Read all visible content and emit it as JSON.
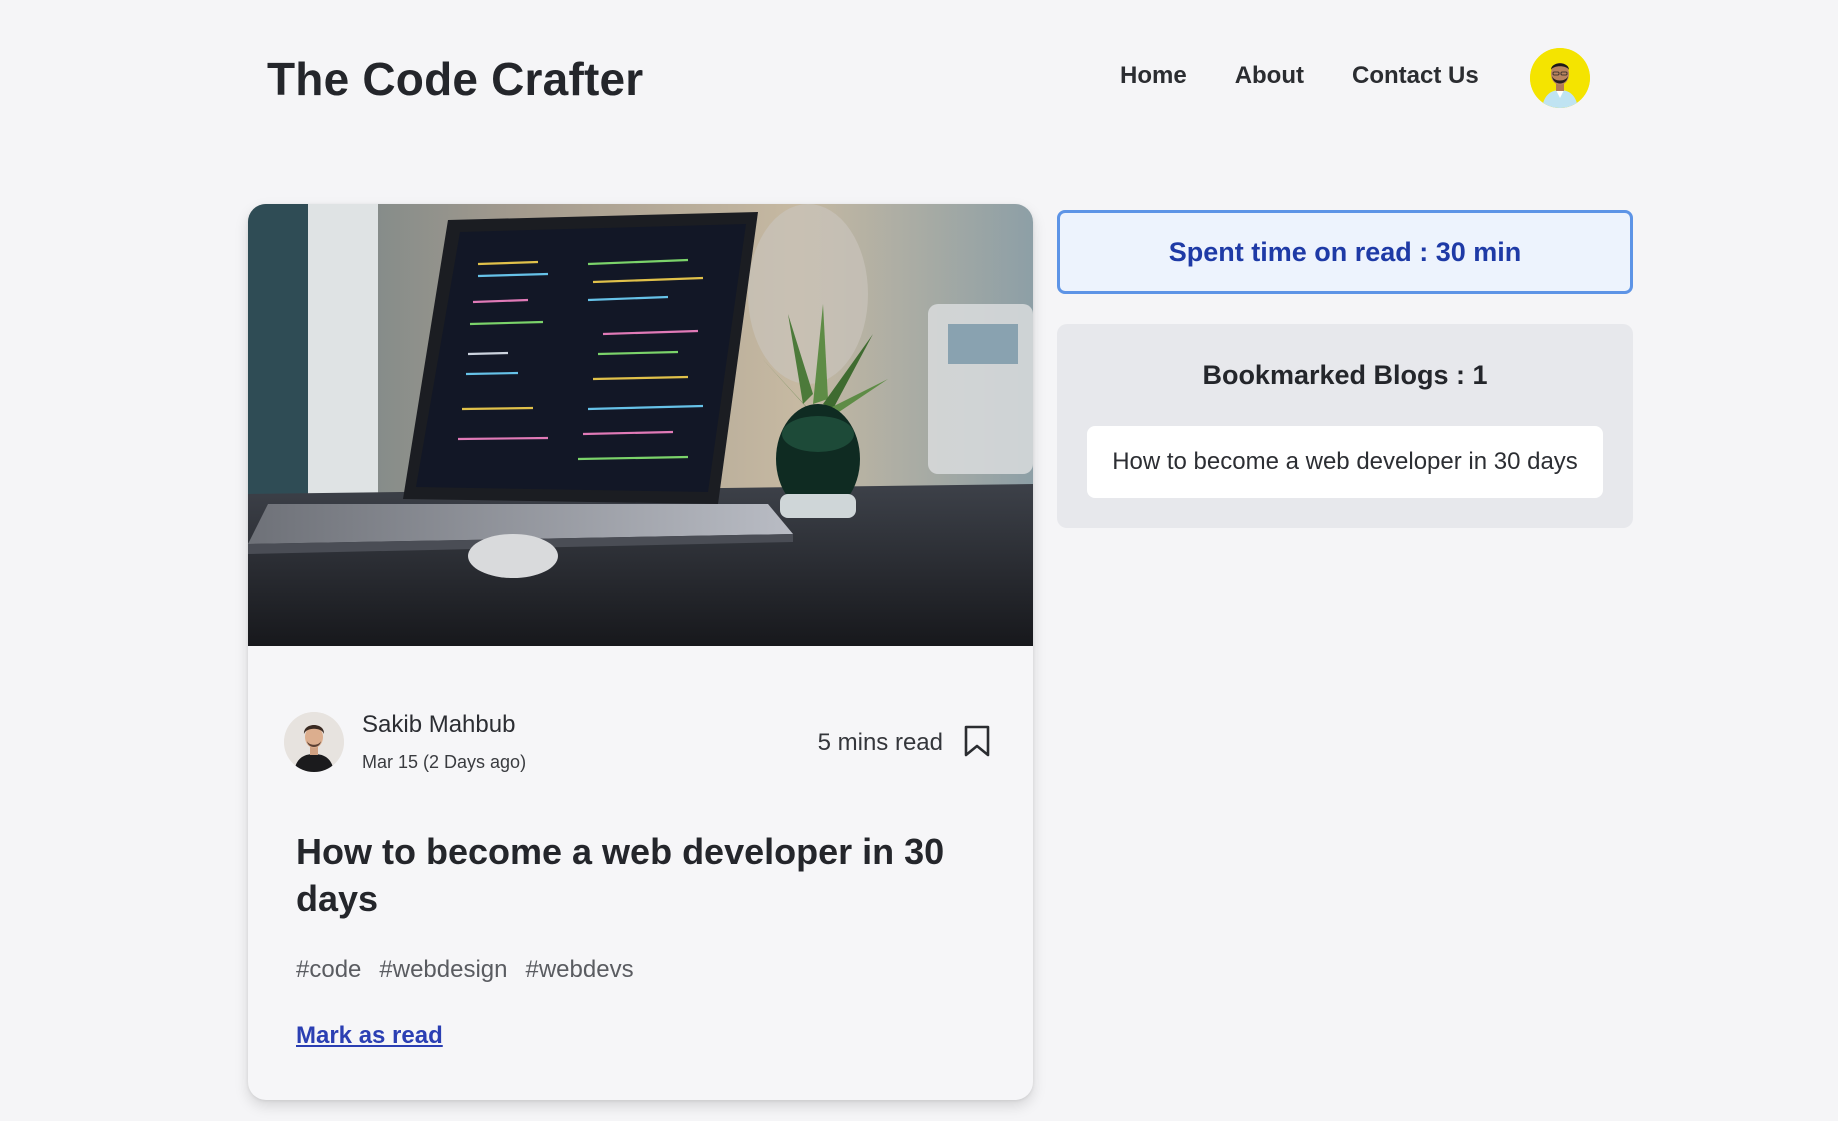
{
  "header": {
    "site_title": "The Code Crafter",
    "nav": [
      "Home",
      "About",
      "Contact Us"
    ],
    "avatar_icon": "user-avatar-icon"
  },
  "blog": {
    "cover_image": "laptop-with-code-photo",
    "author": {
      "name": "Sakib Mahbub",
      "date": "Mar 15 (2 Days ago)",
      "avatar_icon": "author-avatar-icon"
    },
    "read_time": "5 mins read",
    "bookmark_icon": "bookmark-icon",
    "title": "How to become a web developer in 30 days",
    "tags": [
      "#code",
      "#webdesign",
      "#webdevs"
    ],
    "mark_as_read_label": "Mark as read"
  },
  "sidebar": {
    "spent_time_label": "Spent time on read : 30 min",
    "bookmarked_heading": "Bookmarked Blogs : 1",
    "bookmarked_items": [
      "How to become a web developer in 30 days"
    ]
  },
  "colors": {
    "background": "#f5f5f7",
    "accent_blue": "#1e3aa6",
    "spent_border": "#5d94e6",
    "spent_bg": "#edf3fd",
    "link": "#2b3fb3",
    "avatar_yellow": "#f4e400"
  }
}
